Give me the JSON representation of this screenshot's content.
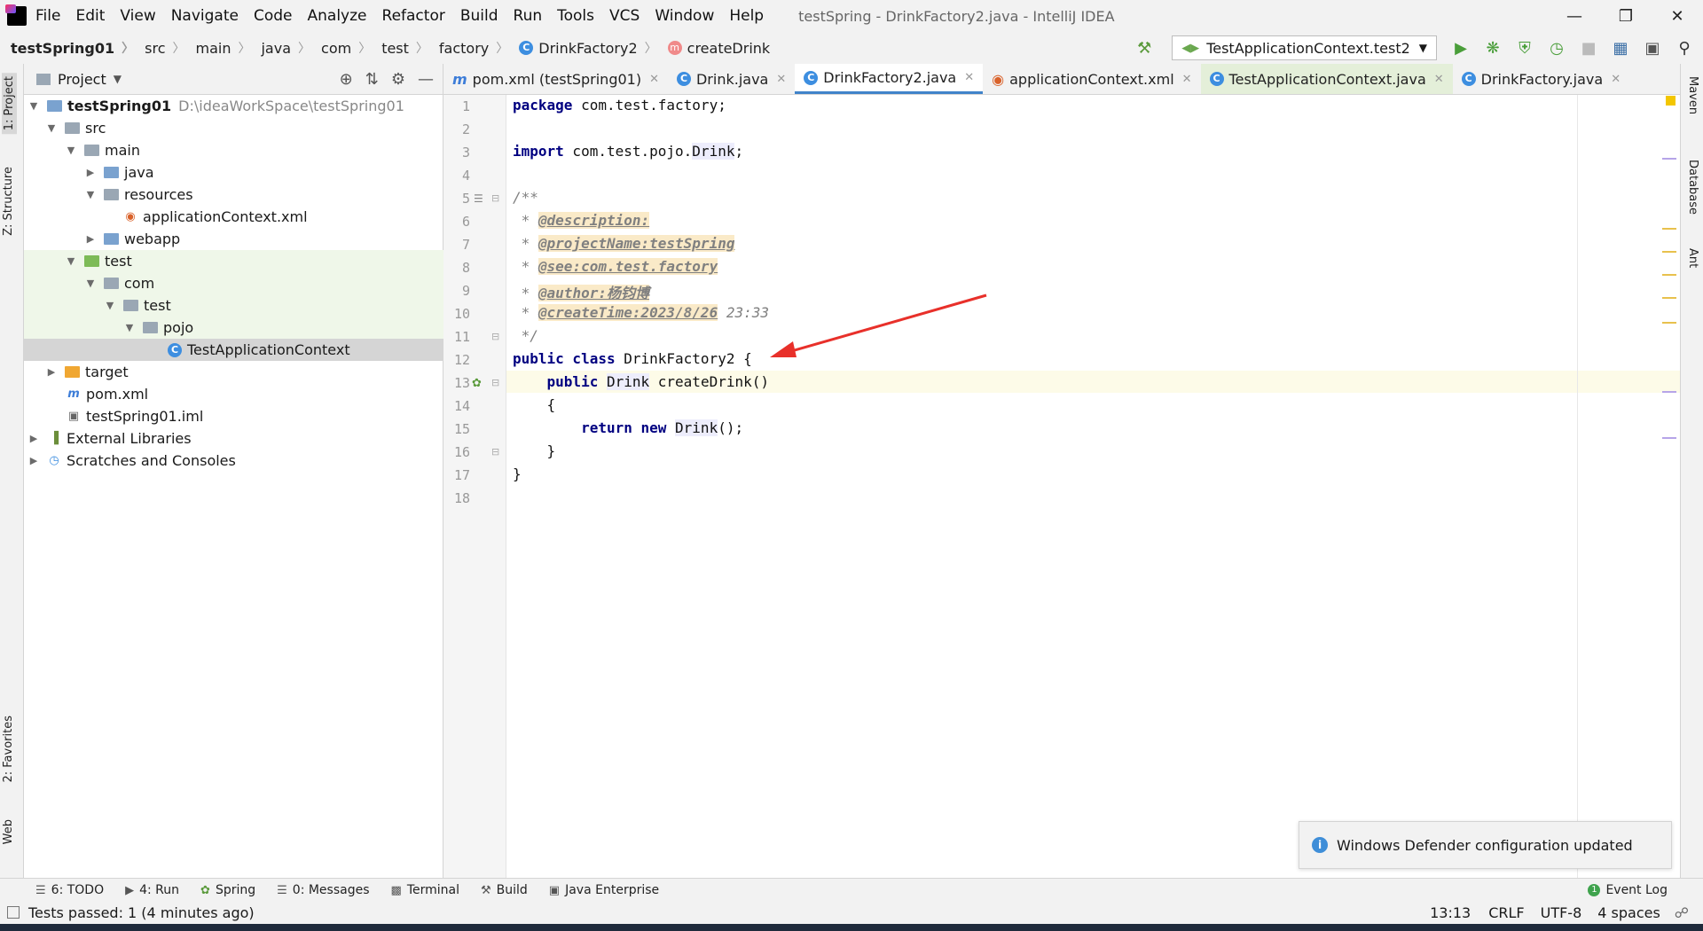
{
  "window": {
    "title": "testSpring - DrinkFactory2.java - IntelliJ IDEA",
    "menu": [
      "File",
      "Edit",
      "View",
      "Navigate",
      "Code",
      "Analyze",
      "Refactor",
      "Build",
      "Run",
      "Tools",
      "VCS",
      "Window",
      "Help"
    ]
  },
  "breadcrumb": [
    "testSpring01",
    "src",
    "main",
    "java",
    "com",
    "test",
    "factory",
    "DrinkFactory2",
    "createDrink"
  ],
  "run_config": "TestApplicationContext.test2",
  "project_panel": {
    "title": "Project",
    "tree": [
      {
        "label": "testSpring01",
        "extra": "D:\\ideaWorkSpace\\testSpring01"
      },
      {
        "label": "src"
      },
      {
        "label": "main"
      },
      {
        "label": "java"
      },
      {
        "label": "resources"
      },
      {
        "label": "applicationContext.xml"
      },
      {
        "label": "webapp"
      },
      {
        "label": "test"
      },
      {
        "label": "com"
      },
      {
        "label": "test"
      },
      {
        "label": "pojo"
      },
      {
        "label": "TestApplicationContext"
      },
      {
        "label": "target"
      },
      {
        "label": "pom.xml"
      },
      {
        "label": "testSpring01.iml"
      },
      {
        "label": "External Libraries"
      },
      {
        "label": "Scratches and Consoles"
      }
    ]
  },
  "tabs": [
    {
      "label": "pom.xml (testSpring01)"
    },
    {
      "label": "Drink.java"
    },
    {
      "label": "DrinkFactory2.java"
    },
    {
      "label": "applicationContext.xml"
    },
    {
      "label": "TestApplicationContext.java"
    },
    {
      "label": "DrinkFactory.java"
    }
  ],
  "editor": {
    "line_numbers": [
      "1",
      "2",
      "3",
      "4",
      "5",
      "6",
      "7",
      "8",
      "9",
      "10",
      "11",
      "12",
      "13",
      "14",
      "15",
      "16",
      "17",
      "18"
    ],
    "lines": {
      "l1a": "package",
      "l1b": " com.test.factory;",
      "l3a": "import",
      "l3b": " com.test.pojo.",
      "l3c": "Drink",
      "l3d": ";",
      "l5": "/**",
      "l6pre": " * ",
      "l6": "@description:",
      "l7pre": " * ",
      "l7": "@projectName:testSpring",
      "l8pre": " * ",
      "l8": "@see:com.test.factory",
      "l9pre": " * ",
      "l9": "@author:杨钧博",
      "l10pre": " * ",
      "l10": "@createTime:2023/8/26",
      "l10b": " 23:33",
      "l11": " */",
      "l12a": "public class",
      "l12b": " DrinkFactory2 {",
      "l13a": "    public",
      "l13b": " ",
      "l13c": "Drink",
      "l13d": " createDrink()",
      "l14": "    {",
      "l15a": "        return new",
      "l15b": " ",
      "l15c": "Drink",
      "l15d": "();",
      "l16": "    }",
      "l17": "}"
    }
  },
  "notification": "Windows Defender configuration updated",
  "left_stripe": [
    "1: Project",
    "Z: Structure",
    "2: Favorites",
    "Web"
  ],
  "right_stripe": [
    "Maven",
    "Database",
    "Ant"
  ],
  "tool_windows": [
    "6: TODO",
    "4: Run",
    "Spring",
    "0: Messages",
    "Terminal",
    "Build",
    "Java Enterprise"
  ],
  "event_log": "Event Log",
  "status": {
    "message": "Tests passed: 1 (4 minutes ago)",
    "position": "13:13",
    "line_sep": "CRLF",
    "encoding": "UTF-8",
    "indent": "4 spaces"
  },
  "colors": {
    "accent": "#4083c9",
    "keyword": "#000080",
    "doc_tag_bg": "#faeac8",
    "arrow": "#e8302a"
  }
}
